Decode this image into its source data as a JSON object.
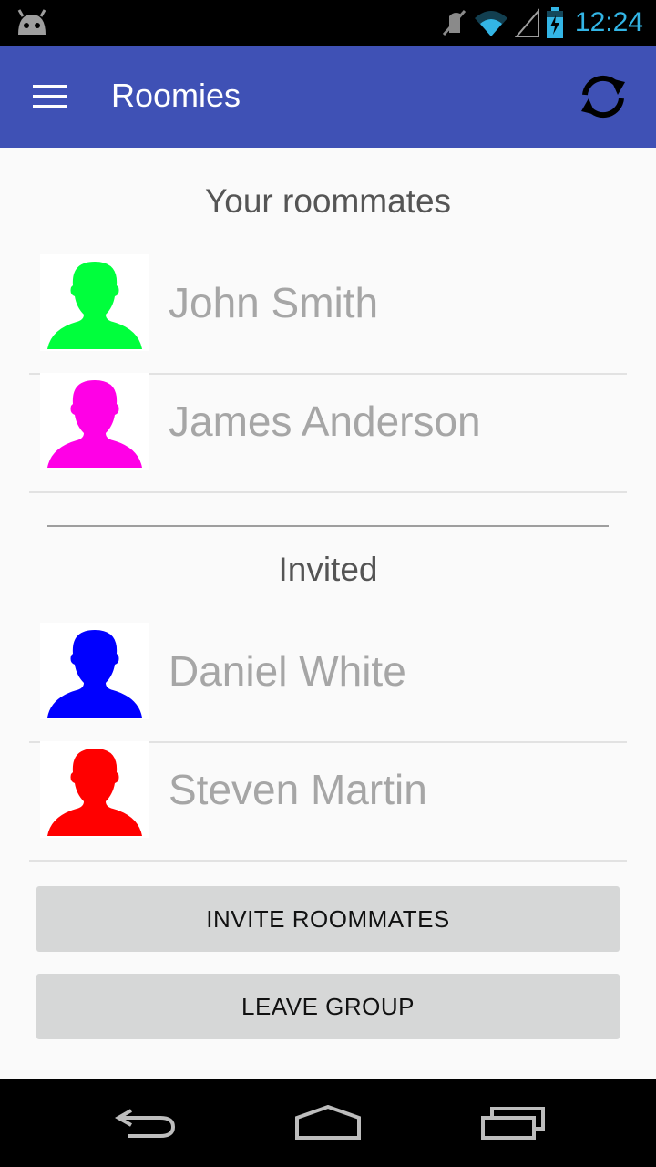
{
  "status_bar": {
    "time": "12:24",
    "icons": [
      "android-icon",
      "mute-icon",
      "wifi-icon",
      "signal-icon",
      "battery-charging-icon"
    ],
    "time_color": "#33b5e5"
  },
  "app_bar": {
    "title": "Roomies",
    "color": "#3f51b5",
    "icons": [
      "menu-icon",
      "sync-icon"
    ]
  },
  "roommates_section": {
    "title": "Your roommates",
    "people": [
      {
        "name": "John Smith",
        "avatar_color": "#00ff3c"
      },
      {
        "name": "James Anderson",
        "avatar_color": "#ff00e6"
      }
    ]
  },
  "invited_section": {
    "title": "Invited",
    "people": [
      {
        "name": "Daniel White",
        "avatar_color": "#0000ff"
      },
      {
        "name": "Steven Martin",
        "avatar_color": "#ff0000"
      }
    ]
  },
  "buttons": {
    "invite": "INVITE ROOMMATES",
    "leave": "LEAVE GROUP"
  },
  "nav_bar": {
    "icons": [
      "back-icon",
      "home-icon",
      "recents-icon"
    ]
  }
}
